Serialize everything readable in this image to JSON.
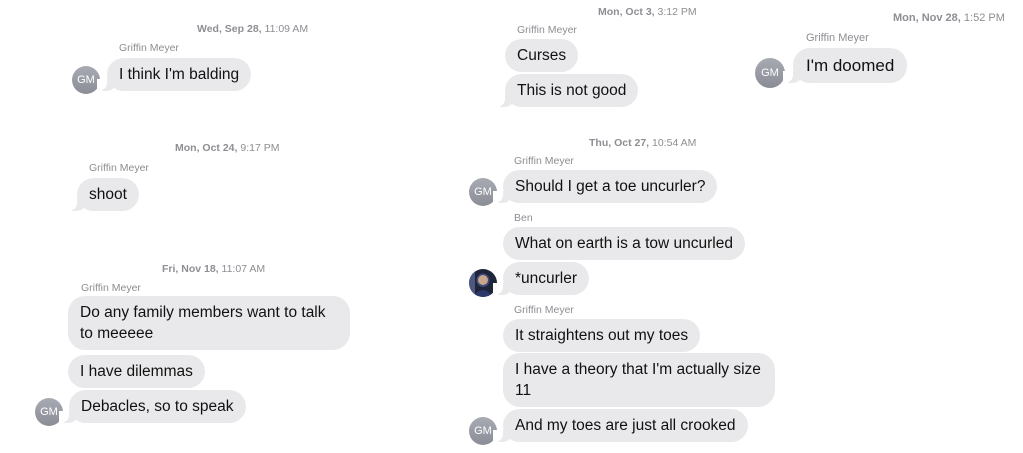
{
  "colors": {
    "bubble": "#e9e9eb",
    "meta_text": "#8e8e93",
    "avatar": "#9a9da5"
  },
  "panels": {
    "p1": {
      "day": "Wed, Sep 28,",
      "time": "11:09 AM",
      "sender": "Griffin Meyer",
      "avatar": "GM",
      "messages": [
        "I think I'm balding"
      ]
    },
    "p2": {
      "day": "Mon, Oct 24,",
      "time": "9:17 PM",
      "sender": "Griffin Meyer",
      "messages": [
        "shoot"
      ]
    },
    "p3": {
      "day": "Fri, Nov 18,",
      "time": "11:07 AM",
      "sender": "Griffin Meyer",
      "avatar": "GM",
      "messages": [
        "Do any family members want to talk to meeeee",
        "I have dilemmas",
        "Debacles, so to speak"
      ]
    },
    "p4": {
      "day": "Mon, Oct 3,",
      "time": "3:12 PM",
      "sender": "Griffin Meyer",
      "messages": [
        "Curses",
        "This is not good"
      ]
    },
    "p5": {
      "day": "Mon, Nov 28,",
      "time": "1:52 PM",
      "sender": "Griffin Meyer",
      "avatar": "GM",
      "messages": [
        "I'm doomed"
      ]
    },
    "p6": {
      "day": "Thu, Oct 27,",
      "time": "10:54 AM",
      "sender1": "Griffin Meyer",
      "avatar1": "GM",
      "msg1": "Should I get a toe uncurler?",
      "sender2": "Ben",
      "msg2": "What on earth is a tow uncurled",
      "msg3": "*uncurler",
      "sender3": "Griffin Meyer",
      "avatar3": "GM",
      "msg4": "It straightens out my toes",
      "msg5": "I have a theory that I'm actually size 11",
      "msg6": "And my toes are just all crooked"
    }
  }
}
